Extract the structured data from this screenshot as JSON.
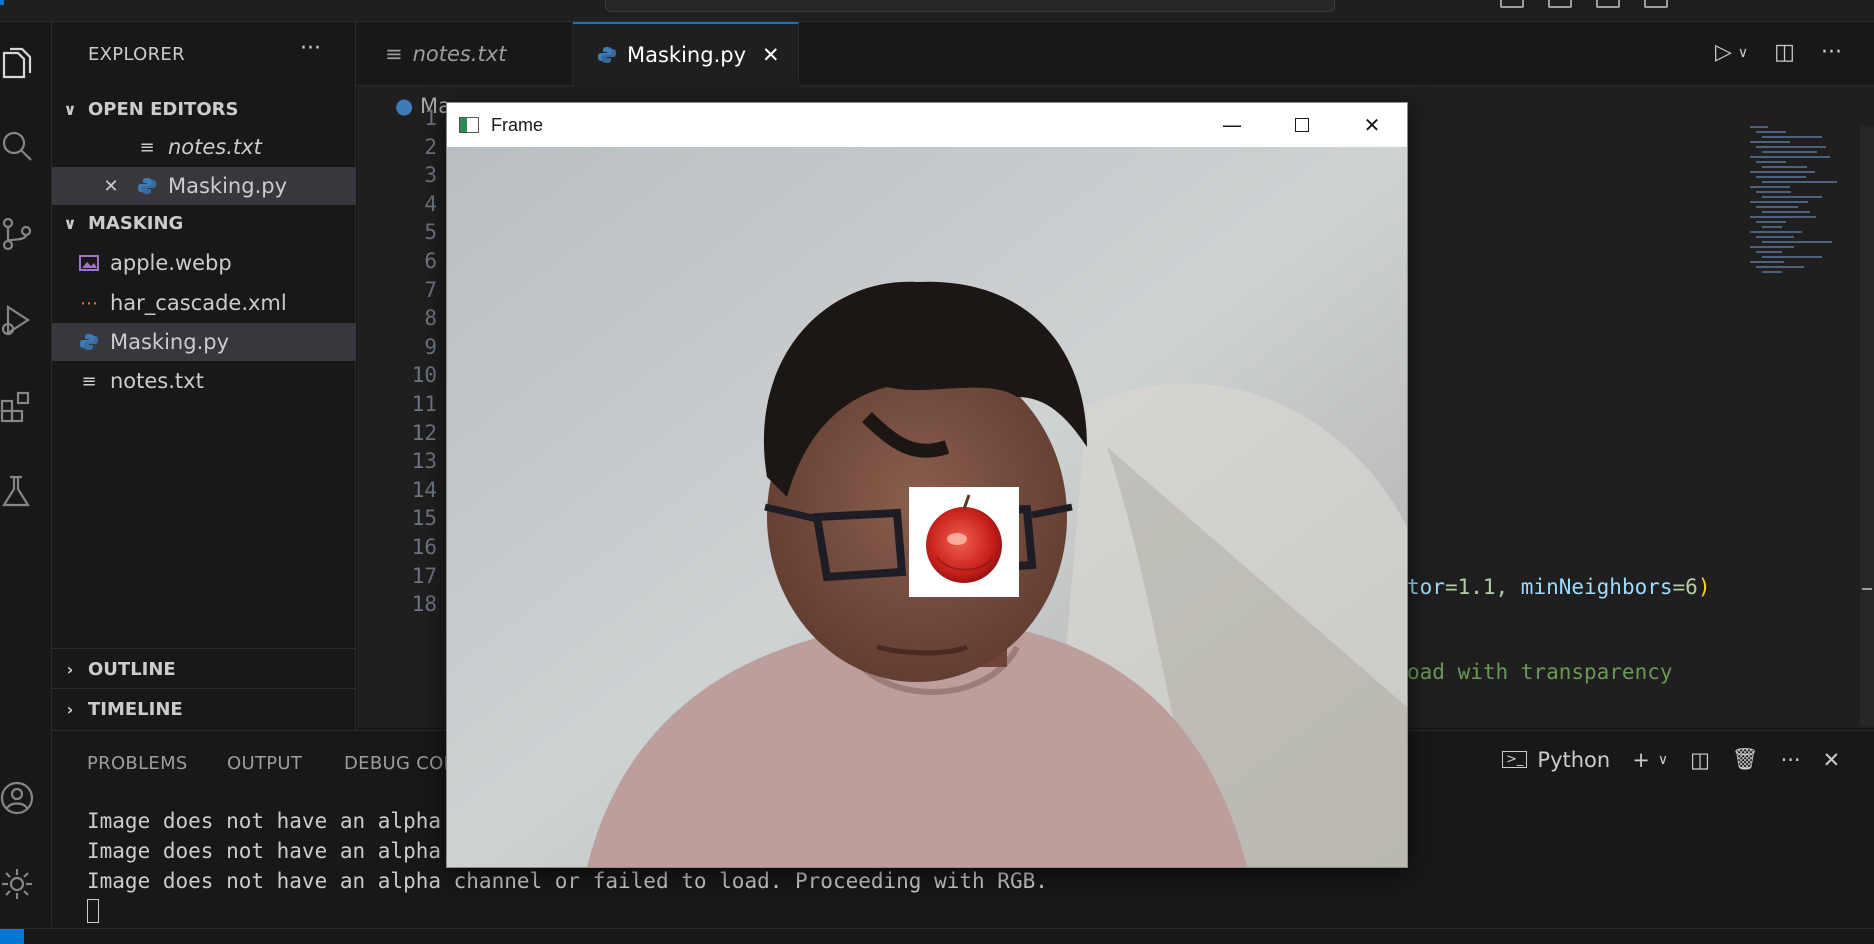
{
  "explorer": {
    "title": "EXPLORER",
    "more": "···",
    "open_editors_label": "OPEN EDITORS",
    "open_editors": [
      {
        "name": "notes.txt"
      },
      {
        "name": "Masking.py"
      }
    ],
    "folder_label": "MASKING",
    "files": [
      {
        "name": "apple.webp",
        "icon": "image-icon"
      },
      {
        "name": "har_cascade.xml",
        "icon": "rss-icon"
      },
      {
        "name": "Masking.py",
        "icon": "python-icon"
      },
      {
        "name": "notes.txt",
        "icon": "text-file-icon"
      }
    ],
    "outline_label": "OUTLINE",
    "timeline_label": "TIMELINE"
  },
  "tabs": [
    {
      "label": "notes.txt"
    },
    {
      "label": "Masking.py"
    }
  ],
  "editor": {
    "breadcrumb": "Ma",
    "line_numbers": [
      "1",
      "2",
      "3",
      "4",
      "5",
      "6",
      "7",
      "8",
      "9",
      "10",
      "11",
      "12",
      "13",
      "14",
      "15",
      "16",
      "17",
      "18"
    ],
    "line14_param1": "tor",
    "line14_val1": "=1.1, ",
    "line14_param2": "minNeighbors",
    "line14_val2": "=6",
    "line14_paren": ")",
    "line17_comment": "oad with transparency"
  },
  "frame_window": {
    "title": "Frame",
    "minimize": "—",
    "close": "✕"
  },
  "panel": {
    "tabs": [
      "PROBLEMS",
      "OUTPUT",
      "DEBUG CON"
    ],
    "terminal_name": "Python",
    "output_lines": [
      "Image does not have an alpha",
      "Image does not have an alpha",
      "Image does not have an alpha channel or failed to load. Proceeding with RGB."
    ]
  },
  "colors": {
    "accent": "#0078d4",
    "background": "#1f1f1f",
    "sidebar": "#181818",
    "selection": "#37373d"
  }
}
